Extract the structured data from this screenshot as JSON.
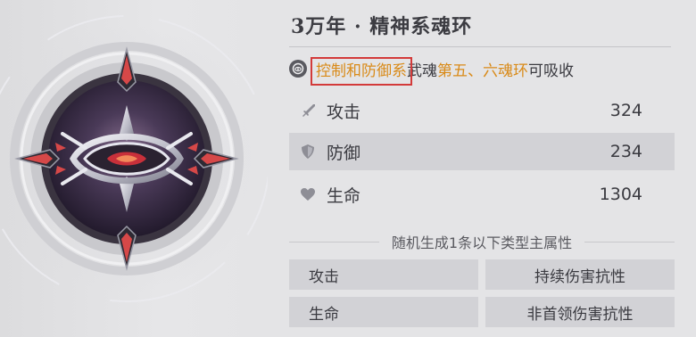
{
  "ring": {
    "title": "3万年 · 精神系魂环",
    "absorb": {
      "highlight_type": "控制和防御系",
      "mid_text": "武魂",
      "highlight_slots": "第五、六魂环",
      "suffix": "可吸收"
    },
    "stats": [
      {
        "label": "攻击",
        "value": "324",
        "icon": "sword-icon"
      },
      {
        "label": "防御",
        "value": "234",
        "icon": "shield-icon"
      },
      {
        "label": "生命",
        "value": "1304",
        "icon": "heart-icon"
      }
    ],
    "random_header": "随机生成1条以下类型主属性",
    "random_attrs": [
      "攻击",
      "持续伤害抗性",
      "生命",
      "非首领伤害抗性"
    ]
  },
  "colors": {
    "highlight": "#d98a18",
    "annotation_box": "#d33a3a"
  }
}
